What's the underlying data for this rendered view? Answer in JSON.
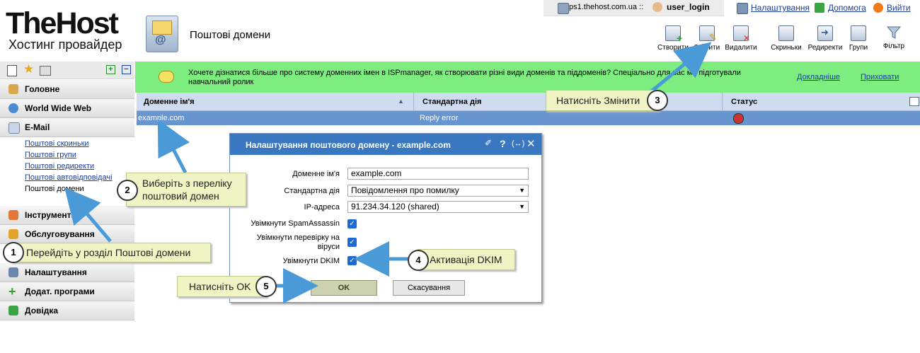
{
  "header": {
    "logo": "TheHost",
    "logo_subtitle": "Хостинг провайдер",
    "page_title": "Поштові домени",
    "server": "ps1.thehost.com.ua ::",
    "user": "user_login",
    "links": [
      "Налаштування",
      "Допомога",
      "Вийти"
    ]
  },
  "toolbar": {
    "buttons": [
      "Створити",
      "Змінити",
      "Видалити",
      "Скриньки",
      "Редиректи",
      "Групи",
      "Фільтр"
    ]
  },
  "sidebar": {
    "sections": [
      {
        "label": "Головне"
      },
      {
        "label": "World Wide Web"
      },
      {
        "label": "E-Mail"
      },
      {
        "label": "Інструменти"
      },
      {
        "label": "Обслуговування"
      },
      {
        "label": "Налаштування"
      },
      {
        "label": "Додат. програми"
      },
      {
        "label": "Довідка"
      }
    ],
    "email_items": [
      "Поштові скриньки",
      "Поштові групи",
      "Поштові редиректи",
      "Поштові автовідповідачі",
      "Поштові домени"
    ]
  },
  "banner": {
    "message": "Хочете дізнатися більше про систему доменних імен в ISPmanager, як створювати різні види доменів та піддоменів? Спеціально для вас ми підготували навчальний ролик",
    "more": "Докладніше",
    "hide": "Приховати"
  },
  "table": {
    "columns": [
      "Доменне ім'я",
      "Стандартна дія",
      "Статус"
    ],
    "rows": [
      {
        "domain": "example.com",
        "action": "Reply error"
      }
    ]
  },
  "dialog": {
    "title": "Налаштування поштового домену - example.com",
    "fields": {
      "domain_label": "Доменне ім'я",
      "domain_value": "example.com",
      "action_label": "Стандартна дія",
      "action_value": "Повідомлення про помилку",
      "ip_label": "IP-адреса",
      "ip_value": "91.234.34.120 (shared)",
      "spam_label": "Увімкнути SpamAssassin",
      "virus_label": "Увімкнути перевірку на віруси",
      "dkim_label": "Увімкнути DKIM"
    },
    "ok": "OK",
    "cancel": "Скасування"
  },
  "callouts": {
    "c1": {
      "num": "1",
      "text": "Перейдіть у розділ Поштові домени"
    },
    "c2": {
      "num": "2",
      "text": "Виберіть з переліку поштовий домен"
    },
    "c3": {
      "num": "3",
      "text": "Натисніть Змінити"
    },
    "c4": {
      "num": "4",
      "text": "Активація DKIM"
    },
    "c5": {
      "num": "5",
      "text": "Натисніть OK"
    }
  },
  "colors": {
    "banner": "#7ced7e",
    "selected_row": "#6795d0",
    "dialog_header": "#3978c0",
    "callout": "#f0f4c4",
    "arrow": "#4a9ad8"
  }
}
